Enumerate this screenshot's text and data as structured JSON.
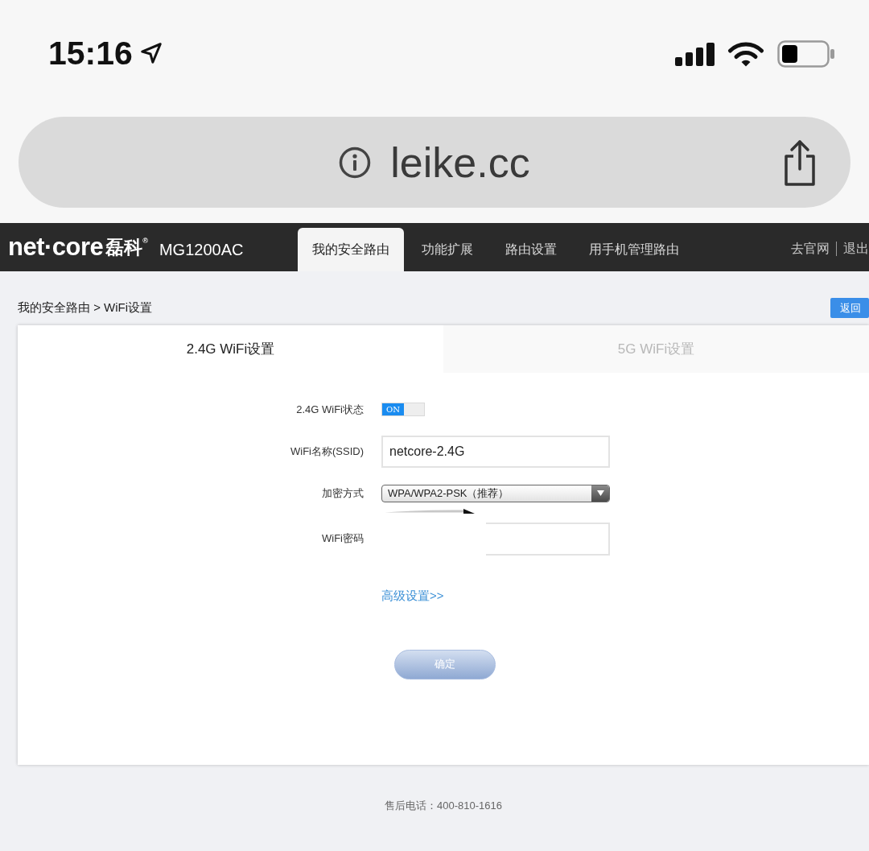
{
  "status_bar": {
    "time": "15:16"
  },
  "address_bar": {
    "url": "leike.cc"
  },
  "router_header": {
    "brand": "net·core",
    "brand_cn": "磊科$^{®}$",
    "model": "MG1200AC",
    "tabs": [
      {
        "label": "我的安全路由",
        "selected": true
      },
      {
        "label": "功能扩展",
        "selected": false
      },
      {
        "label": "路由设置",
        "selected": false
      },
      {
        "label": "用手机管理路由",
        "selected": false
      }
    ],
    "links": [
      "去官网",
      "退出"
    ]
  },
  "breadcrumb": "我的安全路由 > WiFi设置",
  "back_button": "返回",
  "settings_card": {
    "tabs": [
      {
        "label": "2.4G WiFi设置",
        "selected": true
      },
      {
        "label": "5G WiFi设置",
        "selected": false
      }
    ],
    "fields": [
      {
        "kind": "toggle",
        "label": "2.4G WiFi状态",
        "toggle_text": "ON",
        "on": true
      },
      {
        "kind": "text",
        "label": "WiFi名称(SSID)",
        "value": "netcore-2.4G"
      },
      {
        "kind": "select",
        "label": "加密方式",
        "value": "WPA/WPA2-PSK（推荐）"
      },
      {
        "kind": "password",
        "label": "WiFi密码",
        "redacted": true
      }
    ],
    "advanced_link": "高级设置>>",
    "confirm_button": "确定"
  },
  "footer": "售后电话：400-810-1616"
}
